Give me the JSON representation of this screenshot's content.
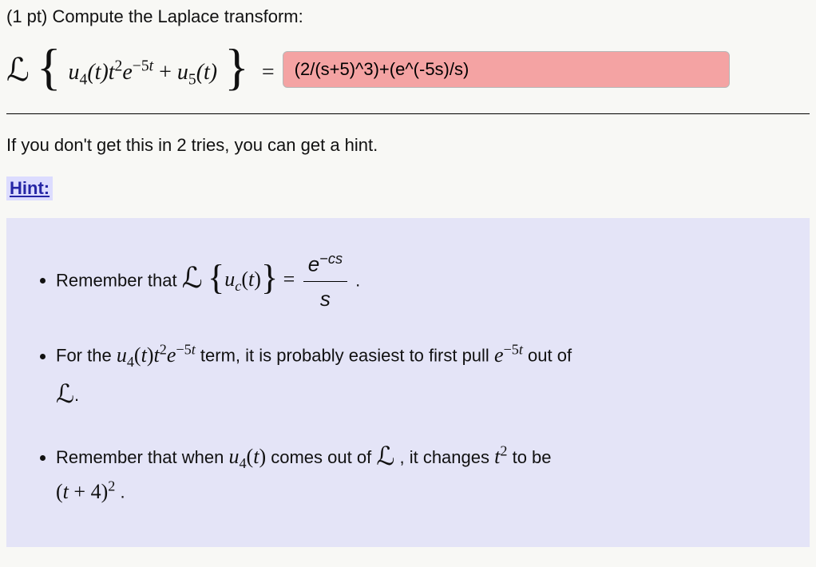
{
  "prompt": {
    "points_prefix": "(1 pt) ",
    "text": "Compute the Laplace transform:"
  },
  "equation": {
    "lhs_math": "u₄(t)t²e⁻⁵ᵗ + u₅(t)",
    "equals": "=",
    "answer_value": "(2/(s+5)^3)+(e^(-5s)/s)"
  },
  "tries_text": "If you don't get this in 2 tries, you can get a hint.",
  "hint_label": "Hint:",
  "hints": {
    "item1_pre": "Remember that ",
    "item1_frac_num": "e⁻ᶜˢ",
    "item1_frac_den": "s",
    "item1_post": " .",
    "item1_inner": "uᶜ(t)",
    "item1_eq": " = ",
    "item2_pre": "For the ",
    "item2_term": "u₄(t)t²e⁻⁵ᵗ",
    "item2_mid": " term, it is probably easiest to first pull ",
    "item2_pull": "e⁻⁵ᵗ",
    "item2_post": " out of ",
    "item2_L": "ℒ",
    "item2_end": ".",
    "item3_pre": "Remember that when ",
    "item3_u4": "u₄(t)",
    "item3_mid": " comes out of ",
    "item3_L": "ℒ",
    "item3_mid2": ", it changes ",
    "item3_t2": "t²",
    "item3_mid3": " to be ",
    "item3_result": "(t + 4)²",
    "item3_end": " ."
  }
}
